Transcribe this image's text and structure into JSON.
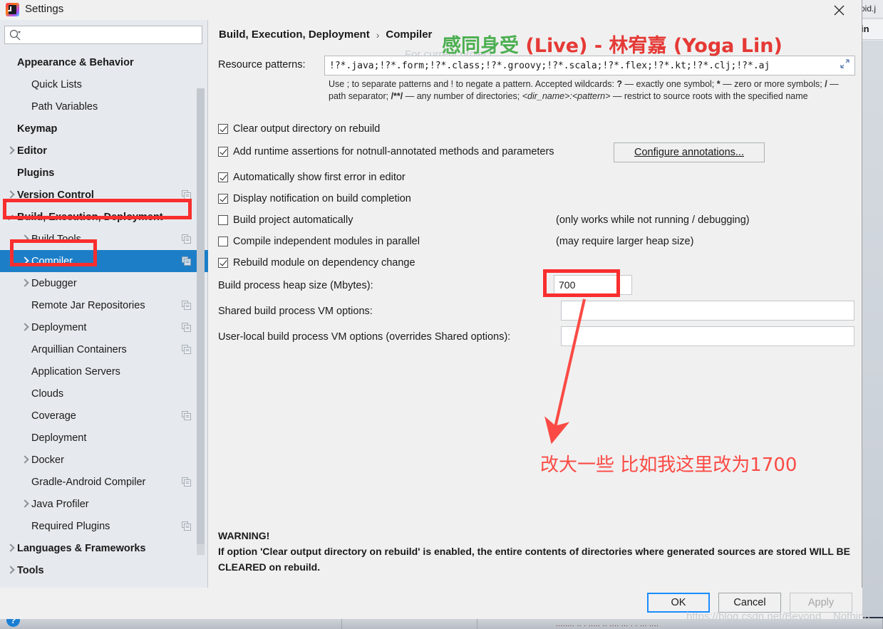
{
  "window": {
    "title": "Settings",
    "app_icon": "intellij-idea-icon",
    "close_icon": "close-icon"
  },
  "sidebar": {
    "search": {
      "value": "",
      "placeholder": "",
      "icon": "search-icon"
    },
    "items": [
      {
        "label": "Appearance & Behavior",
        "indent": 0,
        "bold": true,
        "twisty": "none",
        "selected": false,
        "copy": false
      },
      {
        "label": "Quick Lists",
        "indent": 1,
        "bold": false,
        "twisty": "none",
        "selected": false,
        "copy": false
      },
      {
        "label": "Path Variables",
        "indent": 1,
        "bold": false,
        "twisty": "none",
        "selected": false,
        "copy": false
      },
      {
        "label": "Keymap",
        "indent": 0,
        "bold": true,
        "twisty": "none",
        "selected": false,
        "copy": false
      },
      {
        "label": "Editor",
        "indent": 0,
        "bold": true,
        "twisty": "right",
        "selected": false,
        "copy": false
      },
      {
        "label": "Plugins",
        "indent": 0,
        "bold": true,
        "twisty": "none",
        "selected": false,
        "copy": false
      },
      {
        "label": "Version Control",
        "indent": 0,
        "bold": true,
        "twisty": "right",
        "selected": false,
        "copy": true
      },
      {
        "label": "Build, Execution, Deployment",
        "indent": 0,
        "bold": true,
        "twisty": "down",
        "selected": false,
        "copy": false
      },
      {
        "label": "Build Tools",
        "indent": 1,
        "bold": false,
        "twisty": "right",
        "selected": false,
        "copy": true
      },
      {
        "label": "Compiler",
        "indent": 1,
        "bold": false,
        "twisty": "right",
        "selected": true,
        "copy": true
      },
      {
        "label": "Debugger",
        "indent": 1,
        "bold": false,
        "twisty": "right",
        "selected": false,
        "copy": false
      },
      {
        "label": "Remote Jar Repositories",
        "indent": 1,
        "bold": false,
        "twisty": "none",
        "selected": false,
        "copy": true
      },
      {
        "label": "Deployment",
        "indent": 1,
        "bold": false,
        "twisty": "right",
        "selected": false,
        "copy": true
      },
      {
        "label": "Arquillian Containers",
        "indent": 1,
        "bold": false,
        "twisty": "none",
        "selected": false,
        "copy": true
      },
      {
        "label": "Application Servers",
        "indent": 1,
        "bold": false,
        "twisty": "none",
        "selected": false,
        "copy": false
      },
      {
        "label": "Clouds",
        "indent": 1,
        "bold": false,
        "twisty": "none",
        "selected": false,
        "copy": false
      },
      {
        "label": "Coverage",
        "indent": 1,
        "bold": false,
        "twisty": "none",
        "selected": false,
        "copy": true
      },
      {
        "label": "Deployment",
        "indent": 1,
        "bold": false,
        "twisty": "none",
        "selected": false,
        "copy": false
      },
      {
        "label": "Docker",
        "indent": 1,
        "bold": false,
        "twisty": "right",
        "selected": false,
        "copy": false
      },
      {
        "label": "Gradle-Android Compiler",
        "indent": 1,
        "bold": false,
        "twisty": "none",
        "selected": false,
        "copy": true
      },
      {
        "label": "Java Profiler",
        "indent": 1,
        "bold": false,
        "twisty": "right",
        "selected": false,
        "copy": false
      },
      {
        "label": "Required Plugins",
        "indent": 1,
        "bold": false,
        "twisty": "none",
        "selected": false,
        "copy": true
      },
      {
        "label": "Languages & Frameworks",
        "indent": 0,
        "bold": true,
        "twisty": "right",
        "selected": false,
        "copy": false
      },
      {
        "label": "Tools",
        "indent": 0,
        "bold": true,
        "twisty": "right",
        "selected": false,
        "copy": false
      }
    ],
    "help_button": "?"
  },
  "main": {
    "breadcrumb": {
      "root": "Build, Execution, Deployment",
      "separator": "›",
      "leaf": "Compiler"
    },
    "ghost_label": "For current project",
    "resource_patterns": {
      "label": "Resource patterns:",
      "value": "!?*.java;!?*.form;!?*.class;!?*.groovy;!?*.scala;!?*.flex;!?*.kt;!?*.clj;!?*.aj",
      "expand_icon": "expand-icon"
    },
    "help_text": {
      "part1": "Use ; to separate patterns and ! to negate a pattern. Accepted wildcards: ",
      "q": "?",
      "part2": " — exactly one symbol; ",
      "star": "*",
      "part3": " — zero or more symbols; ",
      "slash": "/",
      "part4": " — path separator; ",
      "globstar": "/**/",
      "part5": " — any number of directories;  ",
      "dirpattern": "<dir_name>:<pattern>",
      "part6": " — restrict to source roots with the specified name"
    },
    "checkboxes": [
      {
        "label": "Clear output directory on rebuild",
        "checked": true
      },
      {
        "label": "Add runtime assertions for notnull-annotated methods and parameters",
        "checked": true
      },
      {
        "label": "Automatically show first error in editor",
        "checked": true
      },
      {
        "label": "Display notification on build completion",
        "checked": true
      },
      {
        "label": "Build project automatically",
        "checked": false
      },
      {
        "label": "Compile independent modules in parallel",
        "checked": false
      },
      {
        "label": "Rebuild module on dependency change",
        "checked": true
      }
    ],
    "hints": {
      "build_auto": "(only works while not running / debugging)",
      "parallel": "(may require larger heap size)"
    },
    "configure_annotations_button": "Configure annotations...",
    "fields": [
      {
        "label": "Build process heap size (Mbytes):",
        "value": "700",
        "placeholder": ""
      },
      {
        "label": "Shared build process VM options:",
        "value": "",
        "placeholder": ""
      },
      {
        "label": "User-local build process VM options (overrides Shared options):",
        "value": "",
        "placeholder": ""
      }
    ],
    "warning": {
      "title": "WARNING!",
      "body": "If option 'Clear output directory on rebuild' is enabled, the entire contents of directories where generated sources are stored WILL BE CLEARED on rebuild."
    }
  },
  "footer": {
    "ok": "OK",
    "cancel": "Cancel",
    "apply": "Apply"
  },
  "annotations": {
    "note_text": "改大一些 比如我这里改为1700",
    "highlight_color": "#f92e2e",
    "arrow_color": "#fb4a45"
  },
  "watermarks": {
    "song_green": "感同身受",
    "song_red": " (Live) - 林宥嘉 (Yoga Lin)",
    "csdn": "https://blog.csdn.net/Beyond__Nothing"
  },
  "background": {
    "tab_label": "oid.j",
    "row_label": "in"
  }
}
